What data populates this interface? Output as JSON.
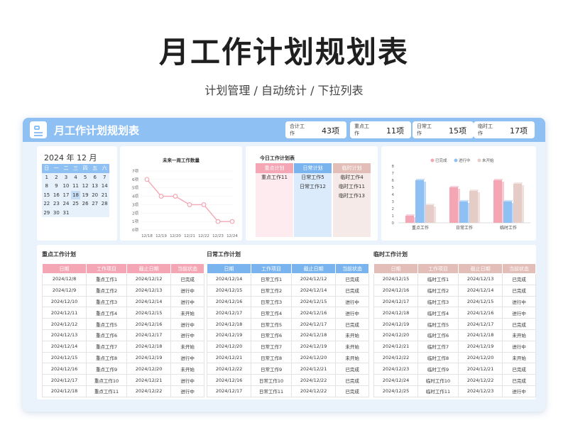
{
  "hero": {
    "title": "月工作计划规划表",
    "subtitle": "计划管理 / 自动统计 / 下拉列表"
  },
  "header": {
    "title": "月工作计划规划表",
    "stats": [
      {
        "label": "合计工作",
        "value": "43项"
      },
      {
        "label": "重点工作",
        "value": "11项"
      },
      {
        "label": "日常工作",
        "value": "15项"
      },
      {
        "label": "临时工作",
        "value": "17项"
      }
    ]
  },
  "calendar": {
    "year": "2024",
    "year_unit": "年",
    "month": "12",
    "month_unit": "月",
    "weekdays": [
      "日",
      "一",
      "二",
      "三",
      "四",
      "五",
      "六"
    ],
    "weeks": [
      [
        "1",
        "2",
        "3",
        "4",
        "5",
        "6",
        "7"
      ],
      [
        "8",
        "9",
        "10",
        "11",
        "12",
        "13",
        "14"
      ],
      [
        "15",
        "16",
        "17",
        "18",
        "19",
        "20",
        "21"
      ],
      [
        "22",
        "23",
        "24",
        "25",
        "26",
        "27",
        "28"
      ],
      [
        "29",
        "30",
        "31",
        "",
        "",
        "",
        ""
      ]
    ],
    "highlight_day": "18"
  },
  "line_chart_title": "未来一周工作数量",
  "today": {
    "title": "今日工作计划表",
    "columns": [
      {
        "header": "重点计划",
        "color": "#f4a6b4",
        "bg": "#fdebef",
        "items": [
          "重点工作11"
        ]
      },
      {
        "header": "日常计划",
        "color": "#7ab4ef",
        "bg": "#dcebfb",
        "items": [
          "日常工作5",
          "日常工作12"
        ]
      },
      {
        "header": "临时计划",
        "color": "#e3bdb7",
        "bg": "#f6eae8",
        "items": [
          "临时工作4",
          "临时工作11",
          "临时工作13"
        ]
      }
    ]
  },
  "colors": {
    "accent": "#8ec0f3",
    "pink": "#f4a6b4",
    "blue": "#7ab4ef",
    "beige": "#e3bdb7"
  },
  "chart_data": [
    {
      "type": "line",
      "title": "未来一周工作数量",
      "x": [
        "12/18",
        "12/19",
        "12/20",
        "12/21",
        "12/22",
        "12/23",
        "12/24"
      ],
      "series": [
        {
          "values": [
            6,
            4,
            4,
            3,
            3,
            1,
            1
          ]
        }
      ],
      "y_ticks": [
        "0项",
        "1项",
        "2项",
        "3项",
        "4项",
        "5项",
        "6项",
        "7项"
      ],
      "ylim": [
        0,
        7
      ],
      "color": "#f4a6b4"
    },
    {
      "type": "bar",
      "categories": [
        "重点工作",
        "日常工作",
        "临时工作"
      ],
      "series": [
        {
          "name": "已完成",
          "values": [
            1,
            5,
            6
          ],
          "color": "#f4a6b4"
        },
        {
          "name": "进行中",
          "values": [
            6,
            3,
            3
          ],
          "color": "#8ec0f3"
        },
        {
          "name": "未开始",
          "values": [
            2.5,
            4.5,
            5.5
          ],
          "color": "#e6ccc6"
        }
      ],
      "y_ticks": [
        "0",
        "1",
        "2",
        "3",
        "4",
        "5",
        "6",
        "7",
        "8"
      ],
      "ylim": [
        0,
        8
      ],
      "legend_position": "top"
    }
  ],
  "tables": [
    {
      "title": "重点工作计划",
      "color": "#f4a6b4",
      "headers": [
        "日期",
        "工作项目",
        "截止日期",
        "当前状态"
      ],
      "rows": [
        [
          "2024/12/8",
          "重点工作1",
          "2024/12/12",
          "已完成"
        ],
        [
          "2024/12/9",
          "重点工作2",
          "2024/12/13",
          "进行中"
        ],
        [
          "2024/12/10",
          "重点工作3",
          "2024/12/14",
          "进行中"
        ],
        [
          "2024/12/11",
          "重点工作4",
          "2024/12/15",
          "未开始"
        ],
        [
          "2024/12/12",
          "重点工作5",
          "2024/12/16",
          "进行中"
        ],
        [
          "2024/12/13",
          "重点工作6",
          "2024/12/17",
          "进行中"
        ],
        [
          "2024/12/14",
          "重点工作7",
          "2024/12/18",
          "未开始"
        ],
        [
          "2024/12/15",
          "重点工作8",
          "2024/12/19",
          "进行中"
        ],
        [
          "2024/12/16",
          "重点工作9",
          "2024/12/20",
          "未开始"
        ],
        [
          "2024/12/17",
          "重点工作10",
          "2024/12/21",
          "进行中"
        ],
        [
          "2024/12/18",
          "重点工作11",
          "2024/12/22",
          "进行中"
        ]
      ]
    },
    {
      "title": "日常工作计划",
      "color": "#7ab4ef",
      "headers": [
        "日期",
        "工作项目",
        "截止日期",
        "当前状态"
      ],
      "rows": [
        [
          "2024/12/14",
          "日常工作1",
          "2024/12/12",
          "已完成"
        ],
        [
          "2024/12/15",
          "日常工作2",
          "2024/12/14",
          "已完成"
        ],
        [
          "2024/12/16",
          "日常工作3",
          "2024/12/15",
          "进行中"
        ],
        [
          "2024/12/17",
          "日常工作4",
          "2024/12/16",
          "进行中"
        ],
        [
          "2024/12/18",
          "日常工作5",
          "2024/12/17",
          "已完成"
        ],
        [
          "2024/12/19",
          "日常工作6",
          "2024/12/18",
          "未开始"
        ],
        [
          "2024/12/20",
          "日常工作7",
          "2024/12/19",
          "未开始"
        ],
        [
          "2024/12/21",
          "日常工作8",
          "2024/12/20",
          "未开始"
        ],
        [
          "2024/12/22",
          "日常工作9",
          "2024/12/21",
          "已完成"
        ],
        [
          "2024/12/16",
          "日常工作10",
          "2024/12/22",
          "已完成"
        ],
        [
          "2024/12/17",
          "日常工作11",
          "2024/12/22",
          "已完成"
        ]
      ]
    },
    {
      "title": "临时工作计划",
      "color": "#e3bdb7",
      "headers": [
        "日期",
        "工作项目",
        "截止日期",
        "当前状态"
      ],
      "rows": [
        [
          "2024/12/15",
          "临时工作1",
          "2024/12/13",
          "已完成"
        ],
        [
          "2024/12/16",
          "临时工作2",
          "2024/12/14",
          "已完成"
        ],
        [
          "2024/12/17",
          "临时工作3",
          "2024/12/15",
          "进行中"
        ],
        [
          "2024/12/18",
          "临时工作4",
          "2024/12/16",
          "进行中"
        ],
        [
          "2024/12/19",
          "临时工作5",
          "2024/12/17",
          "已完成"
        ],
        [
          "2024/12/20",
          "临时工作6",
          "2024/12/18",
          "未开始"
        ],
        [
          "2024/12/21",
          "临时工作7",
          "2024/12/19",
          "进行中"
        ],
        [
          "2024/12/22",
          "临时工作8",
          "2024/12/20",
          "未开始"
        ],
        [
          "2024/12/23",
          "临时工作9",
          "2024/12/21",
          "已完成"
        ],
        [
          "2024/12/24",
          "临时工作10",
          "2024/12/22",
          "已完成"
        ],
        [
          "2024/12/25",
          "临时工作11",
          "2024/12/23",
          "进行中"
        ]
      ]
    }
  ]
}
